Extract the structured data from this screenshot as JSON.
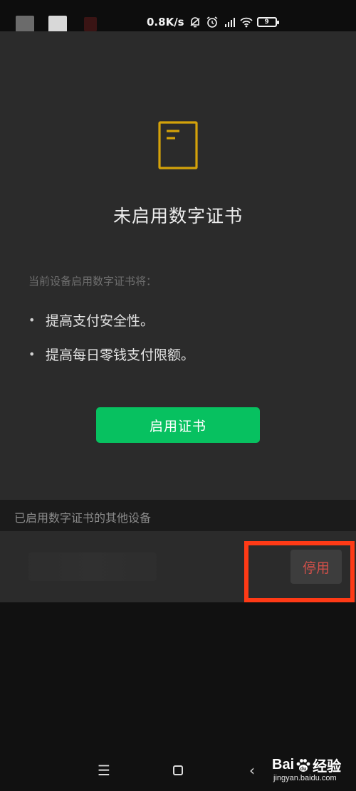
{
  "status_bar": {
    "net_speed": "0.8K/s",
    "battery": "9",
    "icons": [
      "bell-off-icon",
      "alarm-icon",
      "hd-signal-icon",
      "wifi-icon",
      "battery-icon"
    ]
  },
  "main": {
    "icon": "certificate-document-icon",
    "title": "未启用数字证书",
    "intro": "当前设备启用数字证书将：",
    "benefits": [
      "提高支付安全性。",
      "提高每日零钱支付限额。"
    ],
    "bullet": "•",
    "enable_label": "启用证书"
  },
  "devices_section": {
    "title": "已启用数字证书的其他设备",
    "disable_label": "停用"
  },
  "nav": {
    "menu_glyph": "☰",
    "back_glyph": "‹"
  },
  "watermark": {
    "logo_left": "Bai",
    "logo_right": "经验",
    "url": "jingyan.baidu.com"
  },
  "colors": {
    "accent_green": "#07c160",
    "icon_gold": "#d4a20a",
    "danger_red": "#d2504a",
    "highlight": "#ff3a16"
  }
}
